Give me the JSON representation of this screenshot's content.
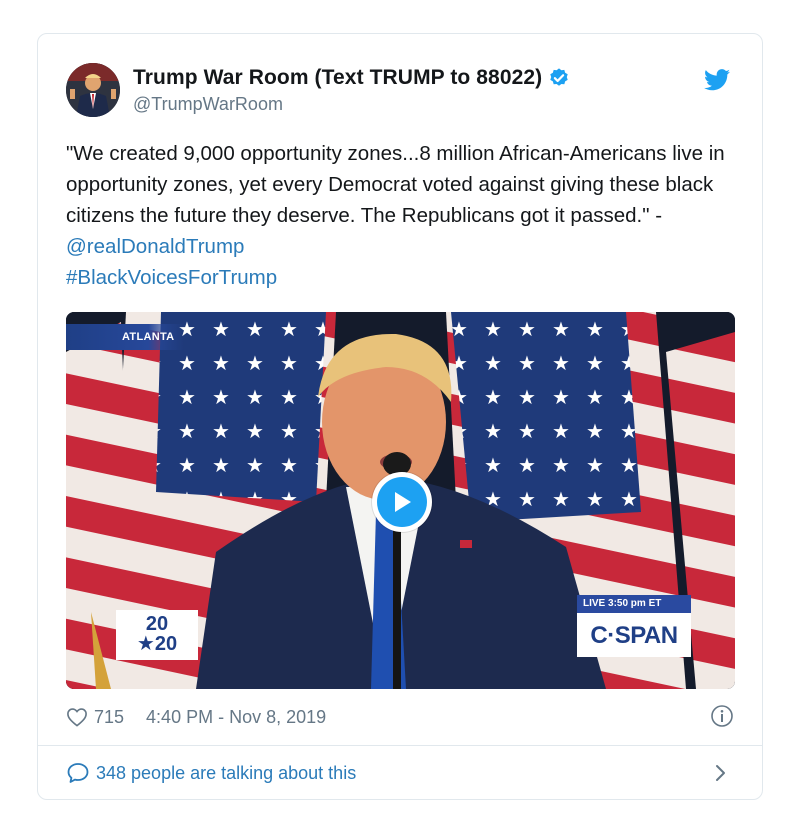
{
  "tweet": {
    "display_name": "Trump War Room (Text TRUMP to 88022)",
    "handle": "@TrumpWarRoom",
    "text": "\"We created 9,000 opportunity zones...8 million African-Americans live in opportunity zones, yet every Democrat voted against giving these black citizens the future they deserve. The Republicans got it passed.\"  - ",
    "mention": "@realDonaldTrump",
    "hashtag": "#BlackVoicesForTrump",
    "likes": "715",
    "timestamp": "4:40 PM - Nov 8, 2019",
    "talking": "348 people are talking about this"
  },
  "video": {
    "location_label": "ATLANTA",
    "live_label": "LIVE  3:50 pm ET",
    "network_label": "C·SPAN",
    "logo_top": "20",
    "logo_bottom": "★20"
  },
  "icons": {
    "verified": "verified-badge-icon",
    "bird": "twitter-bird-icon",
    "play": "play-icon",
    "heart": "heart-icon",
    "info": "info-icon",
    "bubble": "speech-bubble-icon",
    "chevron": "chevron-right-icon"
  },
  "colors": {
    "link": "#2b7bb9",
    "twitter_blue": "#1da1f2",
    "secondary_text": "#657786"
  }
}
